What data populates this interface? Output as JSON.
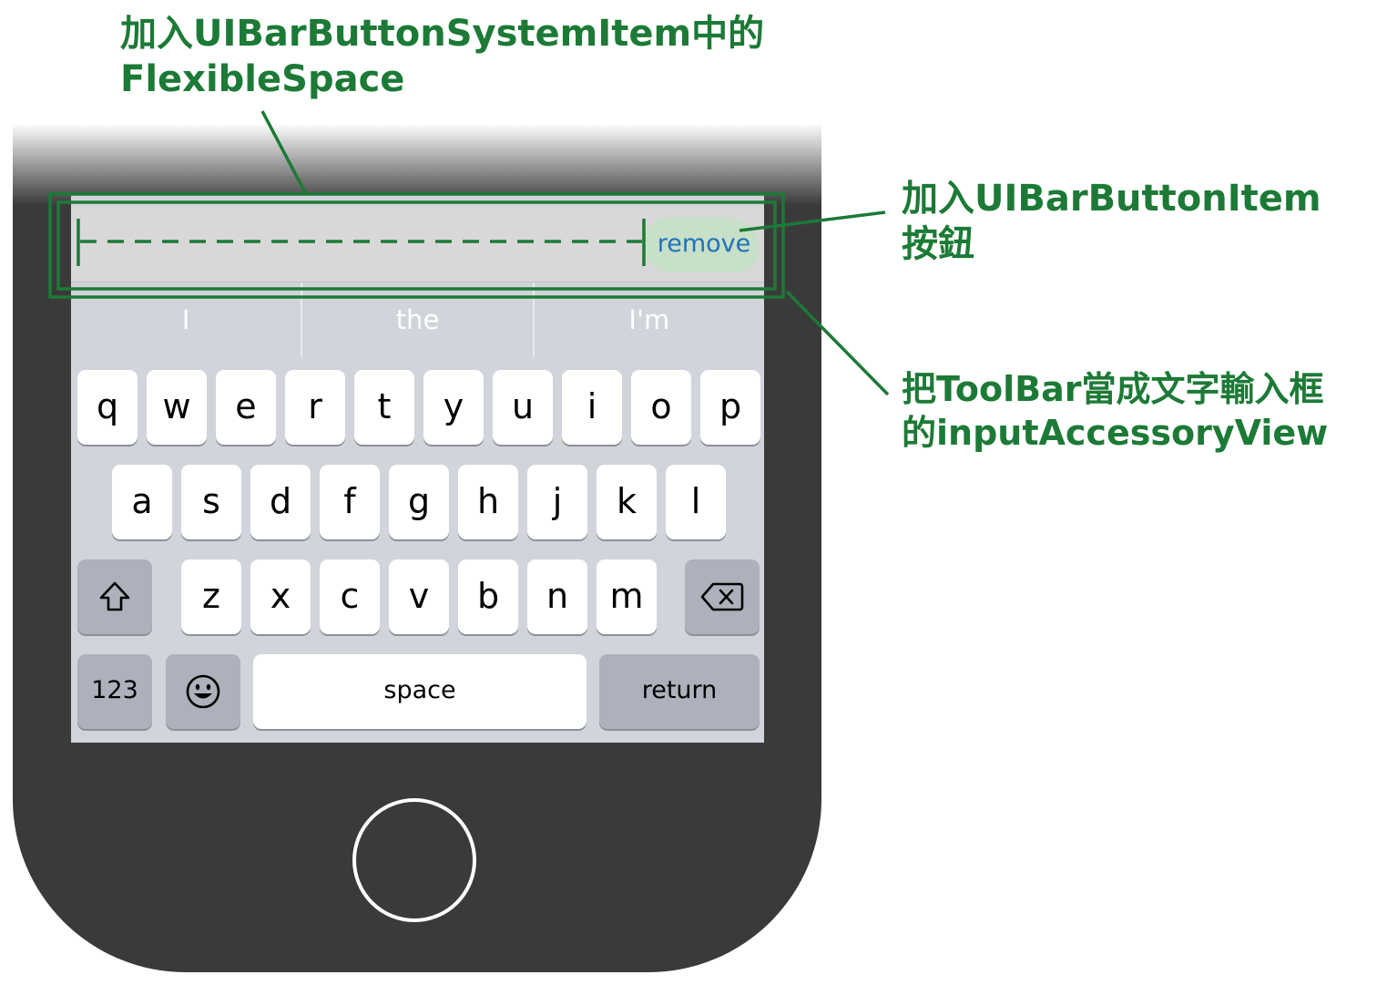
{
  "annotations": {
    "flexible_space_line1": "加入UIBarButtonSystemItem中的",
    "flexible_space_line2": "FlexibleSpace",
    "bar_button_line1": "加入UIBarButtonItem",
    "bar_button_line2": "按鈕",
    "accessory_line1": "把ToolBar當成文字輸入框",
    "accessory_line2": "的inputAccessoryView"
  },
  "toolbar": {
    "remove_label": "remove"
  },
  "suggestions": [
    "I",
    "the",
    "I'm"
  ],
  "keyboard": {
    "row1": [
      "q",
      "w",
      "e",
      "r",
      "t",
      "y",
      "u",
      "i",
      "o",
      "p"
    ],
    "row2": [
      "a",
      "s",
      "d",
      "f",
      "g",
      "h",
      "j",
      "k",
      "l"
    ],
    "row3": [
      "z",
      "x",
      "c",
      "v",
      "b",
      "n",
      "m"
    ],
    "numbers_label": "123",
    "space_label": "space",
    "return_label": "return"
  },
  "icons": {
    "shift": "shift-icon",
    "delete": "delete-icon",
    "emoji": "emoji-icon"
  },
  "colors": {
    "annotation": "#1c7a36",
    "remove_text": "#1f72b8",
    "phone_body": "#3a3a3b",
    "keyboard_bg": "#d1d4da"
  }
}
